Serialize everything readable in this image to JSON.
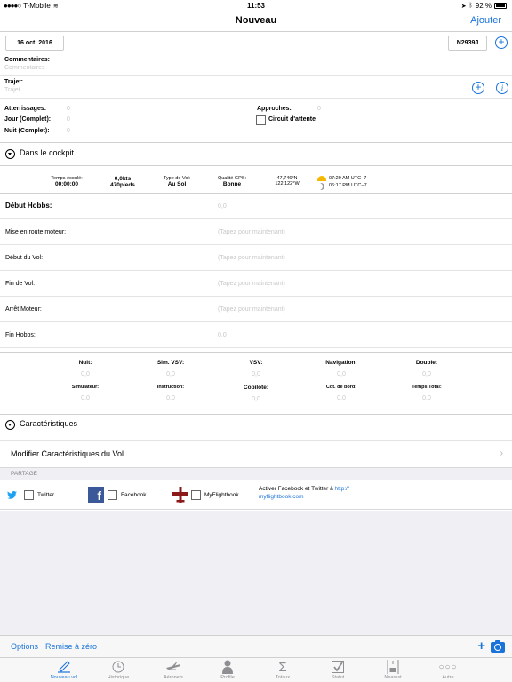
{
  "status": {
    "carrier": "T-Mobile",
    "time": "11:53",
    "battery": "92 %"
  },
  "nav": {
    "title": "Nouveau",
    "add": "Ajouter"
  },
  "flight": {
    "date": "16 oct. 2016",
    "aircraft": "N2939J",
    "comments_label": "Commentaires:",
    "comments_placeholder": "Commentaires",
    "route_label": "Trajet:",
    "route_placeholder": "Trajet"
  },
  "landings": {
    "atterrissages": "Atterrissages:",
    "atterrissages_val": "0",
    "jour": "Jour (Complet):",
    "jour_val": "0",
    "nuit": "Nuit (Complet):",
    "nuit_val": "0",
    "approches": "Approches:",
    "approches_val": "0",
    "circuit": "Circuit d'attente"
  },
  "cockpit": {
    "title": "Dans le cockpit",
    "elapsed_label": "Temps écoulé:",
    "elapsed_val": "00:00:00",
    "speed": "0,0kts",
    "altitude": "470pieds",
    "flight_type_label": "Type de Vol:",
    "flight_type_val": "Au Sol",
    "gps_label": "Qualité GPS:",
    "gps_val": "Bonne",
    "lat": "47,746°N",
    "lon": "122,122°W",
    "sunrise": "07:29 AM UTC−7",
    "sunset": "06:17 PM UTC−7"
  },
  "times": [
    {
      "label": "Début Hobbs:",
      "value": "0,0"
    },
    {
      "label": "Mise en route moteur:",
      "value": "(Tapez pour maintenant)"
    },
    {
      "label": "Début du Vol:",
      "value": "(Tapez pour maintenant)"
    },
    {
      "label": "Fin de Vol:",
      "value": "(Tapez pour maintenant)"
    },
    {
      "label": "Arrêt Moteur:",
      "value": "(Tapez pour maintenant)"
    },
    {
      "label": "Fin Hobbs:",
      "value": "0,0"
    }
  ],
  "totals": [
    {
      "label": "Nuit:",
      "value": "0,0"
    },
    {
      "label": "Sim. VSV:",
      "value": "0,0"
    },
    {
      "label": "VSV:",
      "value": "0,0"
    },
    {
      "label": "Navigation:",
      "value": "0,0"
    },
    {
      "label": "Double:",
      "value": "0,0"
    },
    {
      "label": "Simulateur:",
      "value": "0,0"
    },
    {
      "label": "Instruction:",
      "value": "0,0"
    },
    {
      "label": "Copilote:",
      "value": "0,0"
    },
    {
      "label": "Cdt. de bord:",
      "value": "0,0"
    },
    {
      "label": "Temps Total:",
      "value": "0,0"
    }
  ],
  "characteristics": {
    "title": "Caractéristiques",
    "modify": "Modifier Caractéristiques du Vol"
  },
  "share": {
    "title": "PARTAGE",
    "twitter": "Twitter",
    "facebook": "Facebook",
    "myflightbook": "MyFlightbook",
    "activate_text": "Activer Facebook et Twitter à ",
    "activate_link_1": "http://",
    "activate_link_2": "myflightbook.com"
  },
  "toolbar": {
    "options": "Options",
    "reset": "Remise à zéro"
  },
  "tabs": [
    {
      "label": "Nouveau vol",
      "icon": "pen-icon"
    },
    {
      "label": "Historique",
      "icon": "clock-icon"
    },
    {
      "label": "Aéronefs",
      "icon": "airplane-icon"
    },
    {
      "label": "Profile",
      "icon": "person-icon"
    },
    {
      "label": "Totaux",
      "icon": "sigma-icon"
    },
    {
      "label": "Statut",
      "icon": "checkmark-icon"
    },
    {
      "label": "Nearest",
      "icon": "runway-icon"
    },
    {
      "label": "Autre",
      "icon": "more-icon"
    }
  ],
  "colors": {
    "accent": "#1a73d9",
    "facebook": "#3b5998",
    "twitter": "#1da1f2",
    "myflightbook": "#8b1a1a"
  }
}
